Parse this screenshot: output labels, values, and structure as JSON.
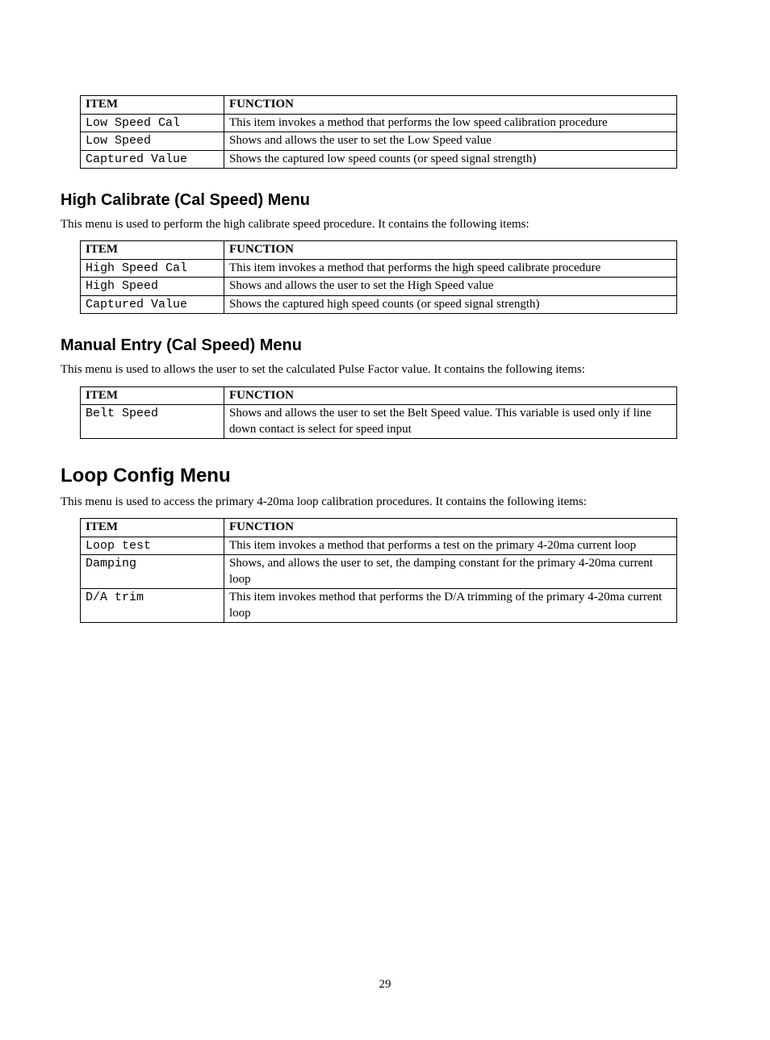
{
  "columns": {
    "item": "ITEM",
    "function": "FUNCTION"
  },
  "table1": {
    "rows": [
      {
        "item": "Low Speed Cal",
        "func": "This item invokes a method that performs the low speed calibration procedure"
      },
      {
        "item": "Low Speed",
        "func": "Shows and allows the user to set  the Low Speed value"
      },
      {
        "item": "Captured Value",
        "func": "Shows the captured low speed counts (or speed signal strength)"
      }
    ]
  },
  "section2": {
    "heading": "High Calibrate (Cal Speed) Menu",
    "intro": "This menu is used to perform the high calibrate speed procedure.  It contains the following items:",
    "rows": [
      {
        "item": "High Speed Cal",
        "func": "This item invokes a method that performs the high speed calibrate procedure"
      },
      {
        "item": "High Speed",
        "func": "Shows and allows the user to set the High Speed value"
      },
      {
        "item": "Captured Value",
        "func": "Shows the captured high speed counts (or speed signal strength)"
      }
    ]
  },
  "section3": {
    "heading": "Manual Entry (Cal Speed) Menu",
    "intro": "This menu is used to allows the user to set the calculated Pulse Factor value.  It contains the following items:",
    "rows": [
      {
        "item": "Belt Speed",
        "func": "Shows and allows the user to set the Belt Speed value.  This variable is used only if line down contact is select for speed input"
      }
    ]
  },
  "section4": {
    "heading": "Loop Config Menu",
    "intro": "This menu is used to access the primary 4-20ma loop calibration procedures.  It contains the following items:",
    "rows": [
      {
        "item": "Loop test",
        "func": "This item invokes a method that performs a test on the primary 4-20ma current loop"
      },
      {
        "item": "Damping",
        "func": "Shows, and allows the user to set, the damping constant for the primary 4-20ma current loop"
      },
      {
        "item": "D/A trim",
        "func": "This item invokes method that performs the D/A trimming of the primary 4-20ma current loop"
      }
    ]
  },
  "page_number": "29"
}
